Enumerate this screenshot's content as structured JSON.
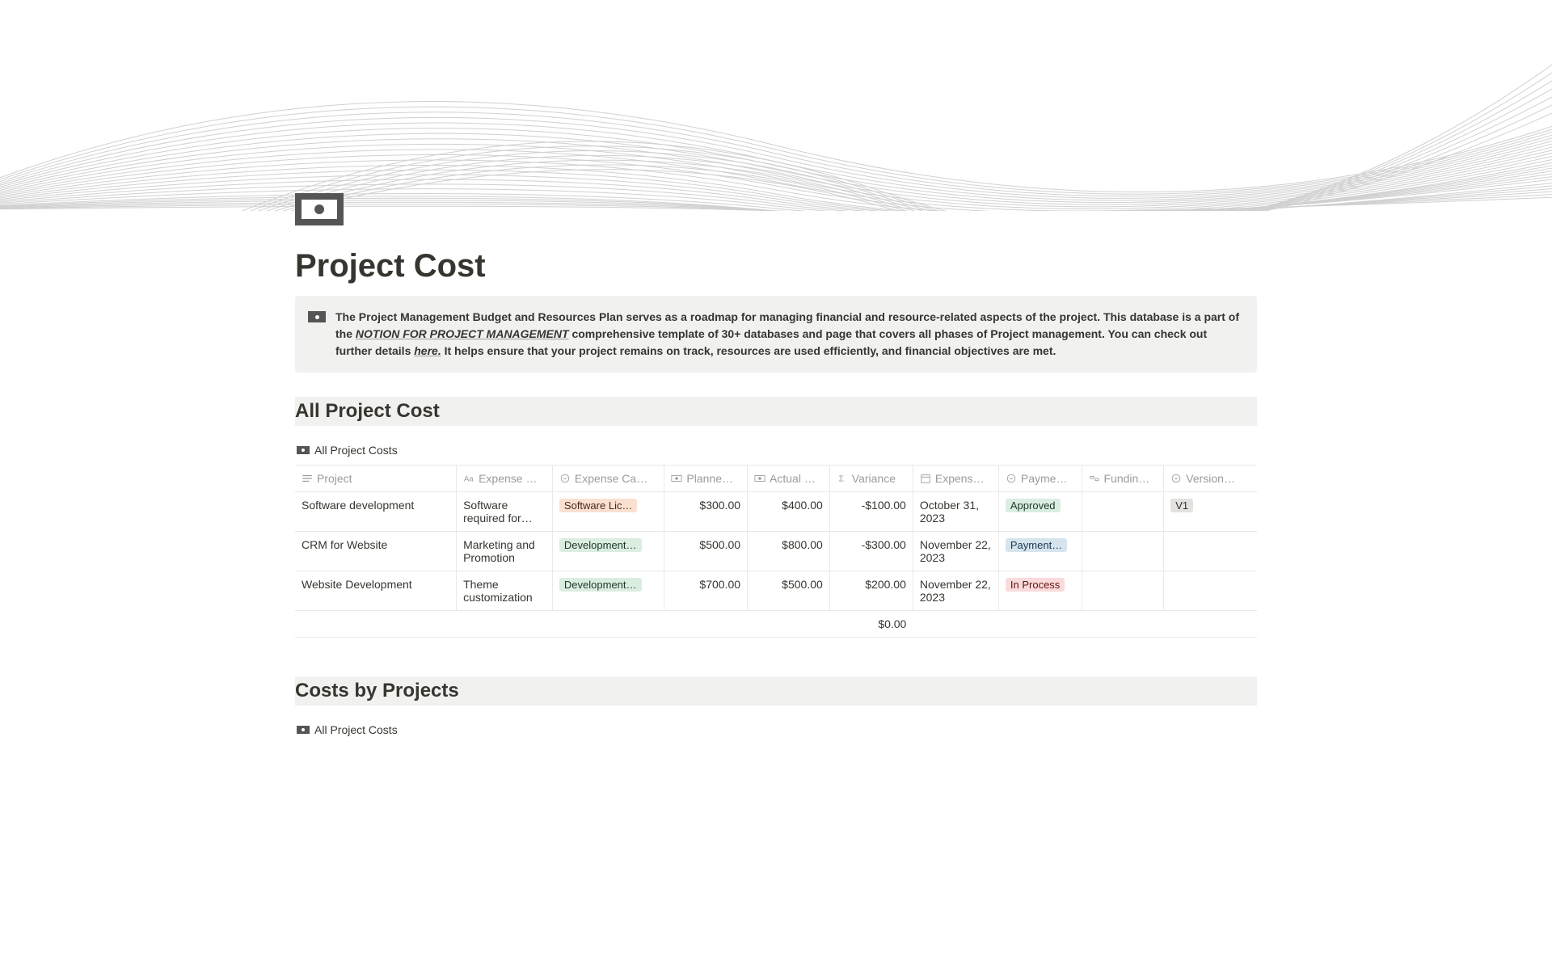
{
  "page": {
    "title": "Project Cost"
  },
  "callout": {
    "text_before_link1": "The Project Management Budget and Resources Plan serves as a roadmap for managing financial and resource-related aspects of the project. This  database is a part of the ",
    "link1_text": "NOTION FOR PROJECT MANAGEMENT",
    "text_mid": " comprehensive template of 30+ databases and page that covers all phases of Project management. You can check out further details ",
    "link2_text": "here.",
    "text_after": " It helps ensure that your project remains on track, resources are used efficiently, and financial objectives are met."
  },
  "sections": {
    "all_cost_title": "All Project Cost",
    "all_cost_view": "All Project Costs",
    "costs_by_projects_title": "Costs by Projects",
    "costs_by_projects_view": "All Project Costs"
  },
  "columns": {
    "project": "Project",
    "expense_descr": "Expense …",
    "expense_cat": "Expense Ca…",
    "planned": "Planne…",
    "actual": "Actual …",
    "variance": "Variance",
    "expense_date": "Expens…",
    "payment": "Payme…",
    "funding": "Fundin…",
    "version": "Version…"
  },
  "rows": [
    {
      "project": "Software development",
      "descr": "Software required for…",
      "cat": "Software Lic…",
      "cat_color": "tag-orange",
      "planned": "$300.00",
      "actual": "$400.00",
      "variance": "-$100.00",
      "date": "October 31, 2023",
      "status": "Approved",
      "status_color": "tag-green",
      "funding": "",
      "version": "V1",
      "version_color": "tag-gray"
    },
    {
      "project": "CRM for Website",
      "descr": "Marketing and Promotion",
      "cat": "Development…",
      "cat_color": "tag-green",
      "planned": "$500.00",
      "actual": "$800.00",
      "variance": "-$300.00",
      "date": "November 22, 2023",
      "status": "Payment…",
      "status_color": "tag-blue",
      "funding": "",
      "version": ""
    },
    {
      "project": "Website Development",
      "descr": "Theme customization",
      "cat": "Development…",
      "cat_color": "tag-green",
      "planned": "$700.00",
      "actual": "$500.00",
      "variance": "$200.00",
      "date": "November 22, 2023",
      "status": "In Process",
      "status_color": "tag-red",
      "funding": "",
      "version": ""
    }
  ],
  "sum_row": {
    "variance": "$0.00"
  }
}
